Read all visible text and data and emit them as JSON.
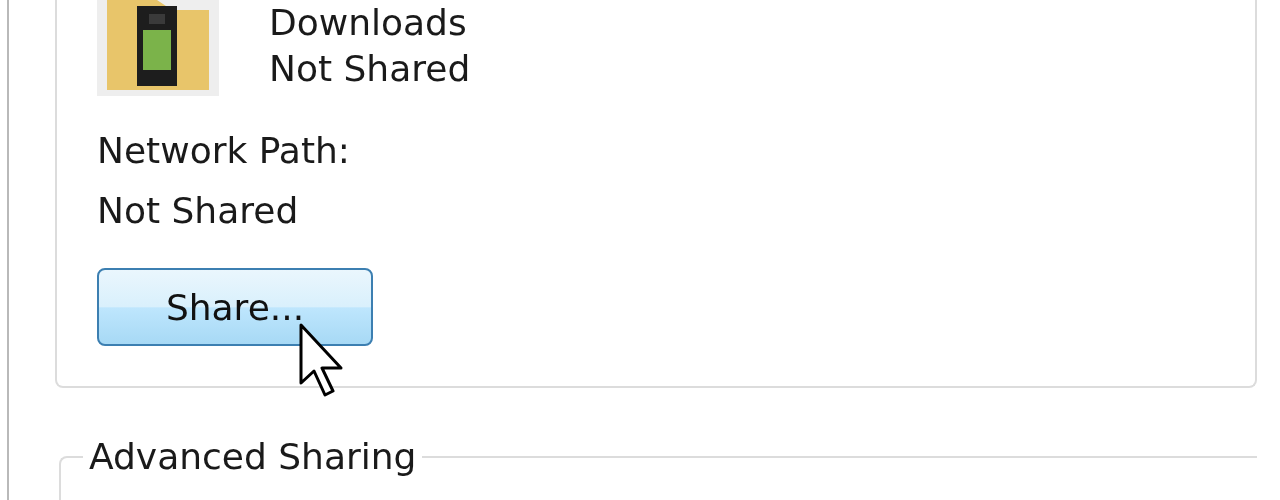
{
  "folder": {
    "name": "Downloads",
    "status": "Not Shared"
  },
  "network_path": {
    "label": "Network Path:",
    "value": "Not Shared"
  },
  "share_button": {
    "label": "Share...",
    "hovered": true
  },
  "advanced_sharing": {
    "title": "Advanced Sharing"
  }
}
